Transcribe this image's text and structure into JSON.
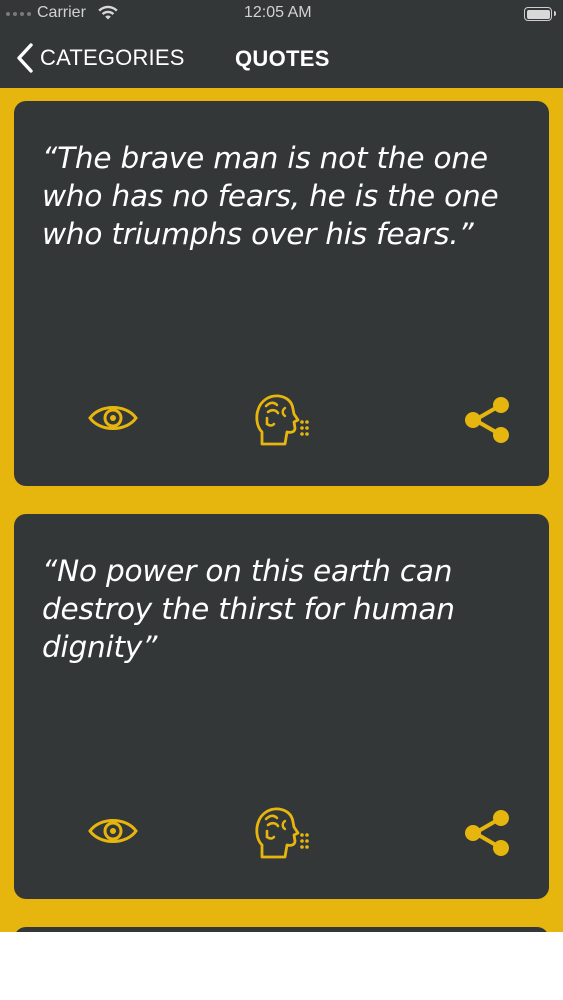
{
  "status_bar": {
    "carrier": "Carrier",
    "time": "12:05 AM"
  },
  "nav": {
    "back_label": "CATEGORIES",
    "title": "QUOTES"
  },
  "colors": {
    "accent": "#E6B60E",
    "card": "#333738",
    "text": "#FFFFFF"
  },
  "quotes": [
    {
      "text": "“The brave man is not the one who has no fears, he is the one who triumphs over his fears.”",
      "actions": [
        "eye-icon",
        "speaking-head-icon",
        "share-icon"
      ]
    },
    {
      "text": "“No power on this earth can destroy the thirst for human dignity”",
      "actions": [
        "eye-icon",
        "speaking-head-icon",
        "share-icon"
      ]
    }
  ]
}
